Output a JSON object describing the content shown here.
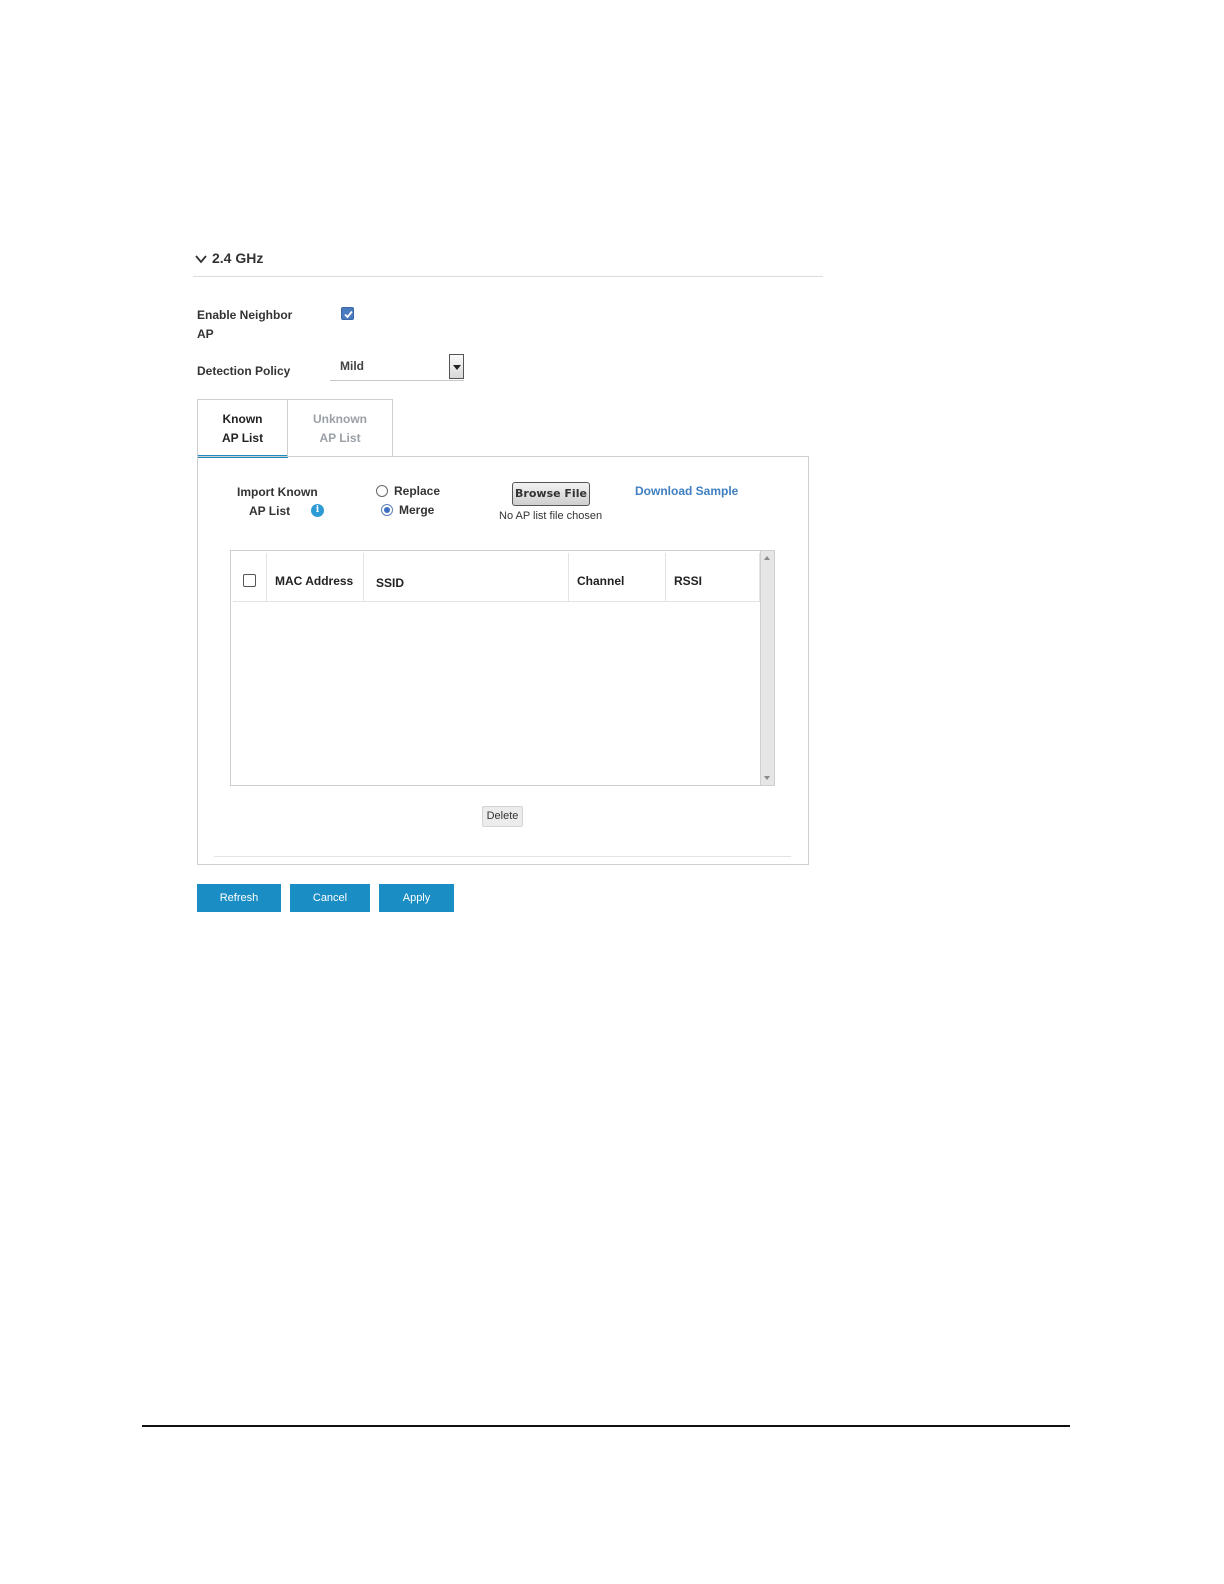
{
  "section": {
    "title": "2.4 GHz",
    "expanded": true
  },
  "settings": {
    "enable_neighbor_label": "Enable Neighbor AP",
    "enable_neighbor_checked": true,
    "detection_policy_label": "Detection Policy",
    "detection_policy_value": "Mild"
  },
  "tabs": [
    {
      "line1": "Known",
      "line2": "AP List",
      "active": true
    },
    {
      "line1": "Unknown",
      "line2": "AP List",
      "active": false
    }
  ],
  "import": {
    "label_line1": "Import Known",
    "label_line2": "AP List",
    "info_glyph": "i",
    "replace_label": "Replace",
    "merge_label": "Merge",
    "selected_mode": "Merge",
    "browse_label": "Browse File",
    "file_status": "No AP list file chosen",
    "download_label": "Download Sample"
  },
  "table": {
    "columns": [
      "MAC Address",
      "SSID",
      "Channel",
      "RSSI"
    ],
    "rows": []
  },
  "delete_label": "Delete",
  "actions": {
    "refresh": "Refresh",
    "cancel": "Cancel",
    "apply": "Apply"
  },
  "colors": {
    "accent": "#1a8ec4",
    "link": "#3f7fc1",
    "checkbox": "#4a7bbf"
  }
}
